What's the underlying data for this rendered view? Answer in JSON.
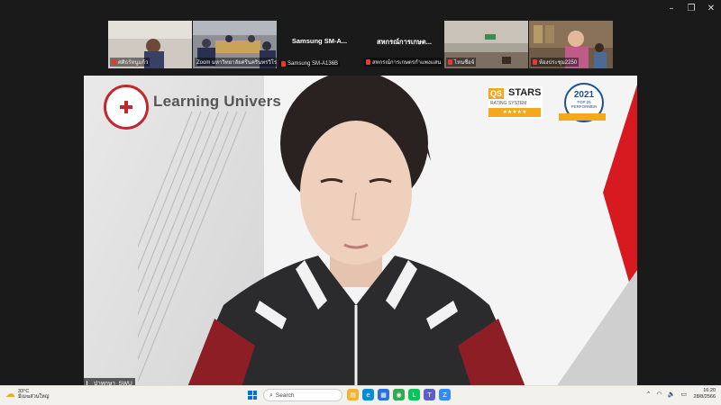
{
  "window": {
    "controls": [
      "–",
      "❐",
      "✕"
    ]
  },
  "participants": [
    {
      "name": "ศศิธร์หนูแก้ว",
      "center_label": ""
    },
    {
      "name": "Zoom มหาวิทยาลัยศรีนครินทรวิโรฒ",
      "center_label": ""
    },
    {
      "name": "Samsung SM-A136B",
      "center_label": "Samsung  SM-A..."
    },
    {
      "name": "สหกรณ์การเกษตรกำแพงแสน",
      "center_label": "สหกรณ์การเกษต..."
    },
    {
      "name": "ไหนชื่อจ์",
      "center_label": ""
    },
    {
      "name": "ห้องประชุม2250",
      "center_label": ""
    }
  ],
  "stage": {
    "brand_text": "Learning Univers",
    "qs": {
      "left": "QS",
      "right": "STARS",
      "sub": "RATING SYSTEM",
      "stars": "★★★★★"
    },
    "badge": {
      "year": "2021",
      "caption": "TOP 25 PERFORMER"
    },
    "speaker_name": "ปาทุกษา_SWU"
  },
  "taskbar": {
    "weather_temp": "33°C",
    "weather_desc": "มีเมฆส่วนใหญ่",
    "search_placeholder": "Search",
    "apps": [
      {
        "icon": "file-explorer-icon",
        "color": "#f2b233",
        "glyph": "▤"
      },
      {
        "icon": "edge-icon",
        "color": "#0b8cd6",
        "glyph": "e"
      },
      {
        "icon": "store-icon",
        "color": "#2a6fdb",
        "glyph": "▦"
      },
      {
        "icon": "chrome-icon",
        "color": "#34a853",
        "glyph": "◉"
      },
      {
        "icon": "line-icon",
        "color": "#06c755",
        "glyph": "L"
      },
      {
        "icon": "teams-icon",
        "color": "#5b5fc7",
        "glyph": "T"
      },
      {
        "icon": "zoom-icon",
        "color": "#2d8cff",
        "glyph": "Z"
      }
    ],
    "time": "16:20",
    "date": "28/8/2566"
  }
}
